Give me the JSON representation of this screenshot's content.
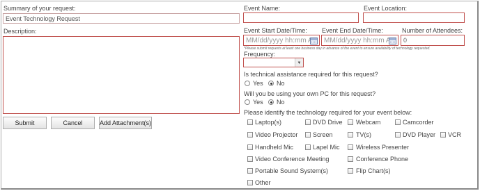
{
  "form": {
    "summary_label": "Summary of your request:",
    "summary_value": "Event Technology Request",
    "description_label": "Description:",
    "description_value": "",
    "event_name_label": "Event Name:",
    "event_name_value": "",
    "event_location_label": "Event Location:",
    "event_location_value": "",
    "start_label": "Event Start Date/Time:",
    "start_placeholder": "MM/dd/yyyy hh:mm A",
    "end_label": "Event End Date/Time:",
    "end_placeholder": "MM/dd/yyyy hh:mm AM",
    "attendees_label": "Number of Attendees:",
    "attendees_value": "0",
    "notice": "*Please submit requests at least one business day in advance of the event to ensure availability of technology requested.",
    "frequency_label": "Frequency:",
    "frequency_value": "",
    "tech_assist_question": "Is technical assistance required for this request?",
    "own_pc_question": "Will you be using your own PC for this request?",
    "yes_label": "Yes",
    "no_label": "No",
    "tech_assist_selected": "No",
    "own_pc_selected": "No",
    "technology_prompt": "Please identify the technology required for your event below:",
    "technology_options": [
      "Laptop(s)",
      "DVD Drive",
      "Webcam",
      "Camcorder",
      "Video Projector",
      "Screen",
      "TV(s)",
      "DVD Player",
      "VCR",
      "Handheld Mic",
      "Lapel Mic",
      "Wireless Presenter",
      "Video Conference Meeting",
      "Conference Phone",
      "Portable Sound System(s)",
      "Flip Chart(s)",
      "Other"
    ]
  },
  "buttons": {
    "submit": "Submit",
    "cancel": "Cancel",
    "add_attachment": "Add Attachment(s)"
  },
  "colors": {
    "required_border": "#c0504d",
    "text": "#444444"
  }
}
